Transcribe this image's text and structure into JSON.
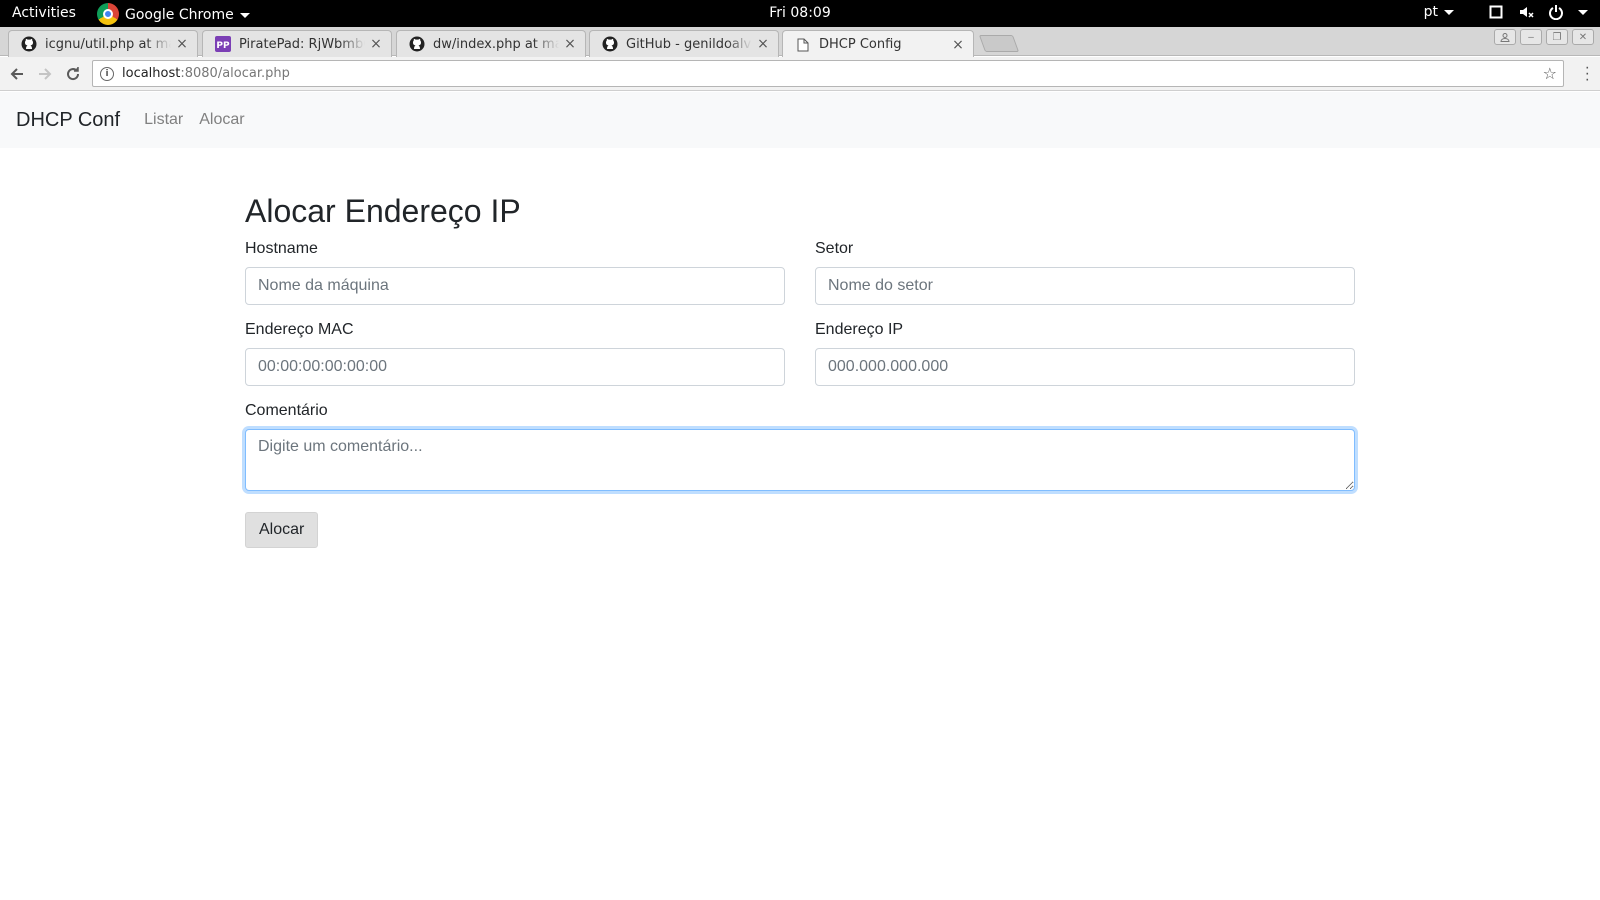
{
  "system": {
    "activities": "Activities",
    "app_name": "Google Chrome",
    "clock": "Fri 08:09",
    "language": "pt"
  },
  "browser": {
    "tabs": [
      {
        "title": "icgnu/util.php at master",
        "favicon": "github-icon"
      },
      {
        "title": "PiratePad: RjWbmbCr",
        "favicon": "piratepad-icon"
      },
      {
        "title": "dw/index.php at master",
        "favicon": "github-icon"
      },
      {
        "title": "GitHub - genildoalves",
        "favicon": "github-icon"
      },
      {
        "title": "DHCP Config",
        "favicon": "page-icon",
        "active": true
      }
    ],
    "url_host": "localhost",
    "url_path": ":8080/alocar.php"
  },
  "navbar": {
    "brand": "DHCP Conf",
    "links": [
      "Listar",
      "Alocar"
    ]
  },
  "form": {
    "title": "Alocar Endereço IP",
    "hostname": {
      "label": "Hostname",
      "placeholder": "Nome da máquina"
    },
    "setor": {
      "label": "Setor",
      "placeholder": "Nome do setor"
    },
    "mac": {
      "label": "Endereço MAC",
      "placeholder": "00:00:00:00:00:00"
    },
    "ip": {
      "label": "Endereço IP",
      "placeholder": "000.000.000.000"
    },
    "comentario": {
      "label": "Comentário",
      "placeholder": "Digite um comentário..."
    },
    "submit_label": "Alocar"
  }
}
